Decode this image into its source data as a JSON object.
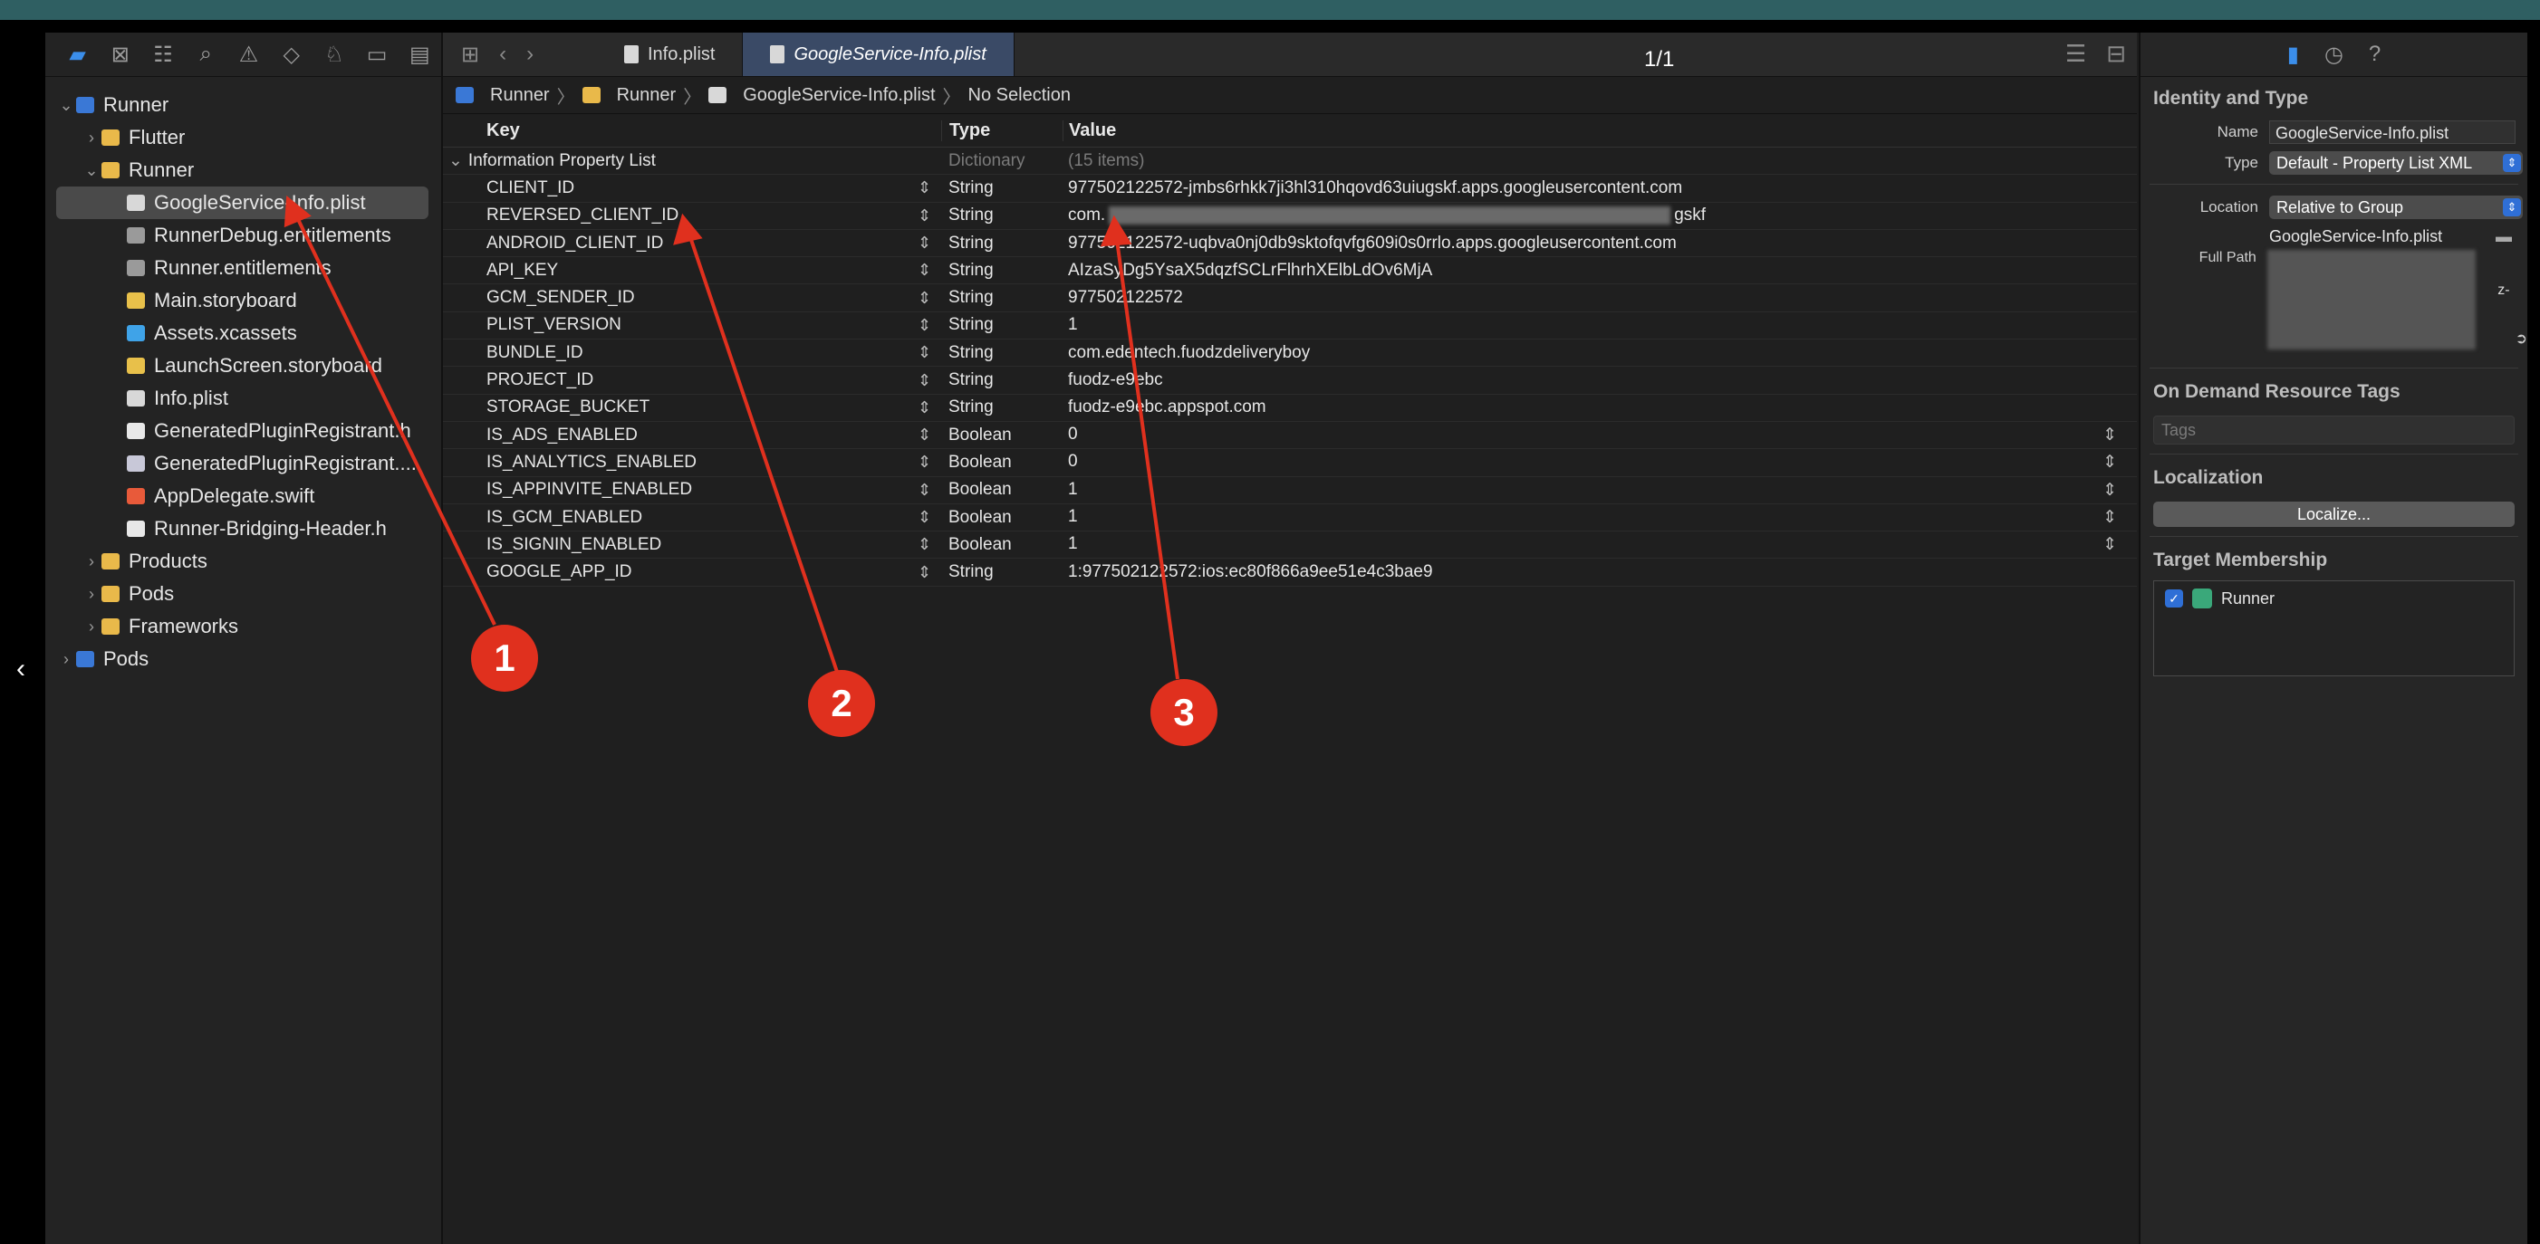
{
  "page_indicator": "1/1",
  "navigator": {
    "items": [
      {
        "label": "Runner",
        "icon": "project-icon",
        "cls": "ic-proj",
        "indent": 0,
        "disc": "⌄"
      },
      {
        "label": "Flutter",
        "icon": "folder-icon",
        "cls": "ic-folder",
        "indent": 1,
        "disc": "›"
      },
      {
        "label": "Runner",
        "icon": "folder-icon",
        "cls": "ic-folder",
        "indent": 1,
        "disc": "⌄"
      },
      {
        "label": "GoogleService-Info.plist",
        "icon": "plist-file-icon",
        "cls": "ic-file",
        "indent": 2,
        "disc": "",
        "selected": true
      },
      {
        "label": "RunnerDebug.entitlements",
        "icon": "entitlements-file-icon",
        "cls": "ic-ent",
        "indent": 2,
        "disc": ""
      },
      {
        "label": "Runner.entitlements",
        "icon": "entitlements-file-icon",
        "cls": "ic-ent",
        "indent": 2,
        "disc": ""
      },
      {
        "label": "Main.storyboard",
        "icon": "storyboard-file-icon",
        "cls": "ic-sb",
        "indent": 2,
        "disc": ""
      },
      {
        "label": "Assets.xcassets",
        "icon": "assets-folder-icon",
        "cls": "ic-assets",
        "indent": 2,
        "disc": ""
      },
      {
        "label": "LaunchScreen.storyboard",
        "icon": "storyboard-file-icon",
        "cls": "ic-sb",
        "indent": 2,
        "disc": ""
      },
      {
        "label": "Info.plist",
        "icon": "plist-file-icon",
        "cls": "ic-file",
        "indent": 2,
        "disc": ""
      },
      {
        "label": "GeneratedPluginRegistrant.h",
        "icon": "header-file-icon",
        "cls": "ic-h",
        "indent": 2,
        "disc": ""
      },
      {
        "label": "GeneratedPluginRegistrant....",
        "icon": "objc-file-icon",
        "cls": "ic-m",
        "indent": 2,
        "disc": ""
      },
      {
        "label": "AppDelegate.swift",
        "icon": "swift-file-icon",
        "cls": "ic-swift",
        "indent": 2,
        "disc": ""
      },
      {
        "label": "Runner-Bridging-Header.h",
        "icon": "header-file-icon",
        "cls": "ic-h",
        "indent": 2,
        "disc": ""
      },
      {
        "label": "Products",
        "icon": "folder-icon",
        "cls": "ic-folder",
        "indent": 1,
        "disc": "›"
      },
      {
        "label": "Pods",
        "icon": "folder-icon",
        "cls": "ic-folder",
        "indent": 1,
        "disc": "›"
      },
      {
        "label": "Frameworks",
        "icon": "folder-icon",
        "cls": "ic-folder",
        "indent": 1,
        "disc": "›"
      },
      {
        "label": "Pods",
        "icon": "project-icon",
        "cls": "ic-proj",
        "indent": 0,
        "disc": "›"
      }
    ]
  },
  "tabs": {
    "info": "Info.plist",
    "google": "GoogleService-Info.plist"
  },
  "jumpbar": {
    "p1": "Runner",
    "p2": "Runner",
    "p3": "GoogleService-Info.plist",
    "p4": "No Selection"
  },
  "plist": {
    "headers": {
      "key": "Key",
      "type": "Type",
      "value": "Value"
    },
    "root": {
      "key": "Information Property List",
      "type": "Dictionary",
      "value": "(15 items)"
    },
    "rows": [
      {
        "key": "CLIENT_ID",
        "type": "String",
        "value": "977502122572-jmbs6rhkk7ji3hl310hqovd63uiugskf.apps.googleusercontent.com"
      },
      {
        "key": "REVERSED_CLIENT_ID",
        "type": "String",
        "value": "com.",
        "value_tail": "gskf",
        "redacted": true
      },
      {
        "key": "ANDROID_CLIENT_ID",
        "type": "String",
        "value": "977502122572-uqbva0nj0db9sktofqvfg609i0s0rrlo.apps.googleusercontent.com"
      },
      {
        "key": "API_KEY",
        "type": "String",
        "value": "AIzaSyDg5YsaX5dqzfSCLrFlhrhXElbLdOv6MjA"
      },
      {
        "key": "GCM_SENDER_ID",
        "type": "String",
        "value": "977502122572"
      },
      {
        "key": "PLIST_VERSION",
        "type": "String",
        "value": "1"
      },
      {
        "key": "BUNDLE_ID",
        "type": "String",
        "value": "com.edentech.fuodzdeliveryboy"
      },
      {
        "key": "PROJECT_ID",
        "type": "String",
        "value": "fuodz-e9ebc"
      },
      {
        "key": "STORAGE_BUCKET",
        "type": "String",
        "value": "fuodz-e9ebc.appspot.com"
      },
      {
        "key": "IS_ADS_ENABLED",
        "type": "Boolean",
        "value": "0",
        "stepper": true
      },
      {
        "key": "IS_ANALYTICS_ENABLED",
        "type": "Boolean",
        "value": "0",
        "stepper": true
      },
      {
        "key": "IS_APPINVITE_ENABLED",
        "type": "Boolean",
        "value": "1",
        "stepper": true
      },
      {
        "key": "IS_GCM_ENABLED",
        "type": "Boolean",
        "value": "1",
        "stepper": true
      },
      {
        "key": "IS_SIGNIN_ENABLED",
        "type": "Boolean",
        "value": "1",
        "stepper": true
      },
      {
        "key": "GOOGLE_APP_ID",
        "type": "String",
        "value": "1:977502122572:ios:ec80f866a9ee51e4c3bae9"
      }
    ]
  },
  "inspector": {
    "identity_title": "Identity and Type",
    "name_label": "Name",
    "name_value": "GoogleService-Info.plist",
    "type_label": "Type",
    "type_value": "Default - Property List XML",
    "location_label": "Location",
    "location_value": "Relative to Group",
    "location_file": "GoogleService-Info.plist",
    "fullpath_label": "Full Path",
    "fullpath_tail": "z-",
    "odr_title": "On Demand Resource Tags",
    "tags_placeholder": "Tags",
    "localization_title": "Localization",
    "localize_button": "Localize...",
    "target_title": "Target Membership",
    "target_name": "Runner"
  },
  "annotations": [
    {
      "label": "1"
    },
    {
      "label": "2"
    },
    {
      "label": "3"
    }
  ],
  "colors": {
    "annotation": "#e0301e",
    "accent": "#3b8eea",
    "selection": "#3a4a66"
  }
}
